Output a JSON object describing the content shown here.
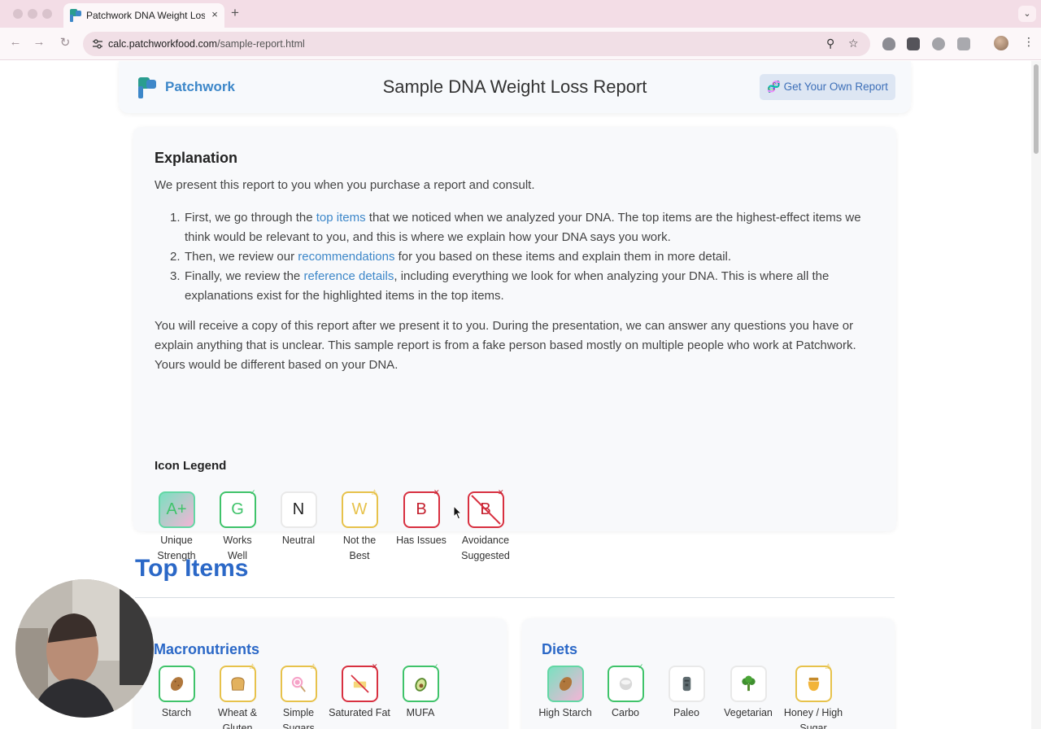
{
  "browser": {
    "tab_title": "Patchwork DNA Weight Loss",
    "tab_close": "×",
    "new_tab": "+",
    "tab_menu": "⌄",
    "url_host": "calc.patchworkfood.com",
    "url_path": "/sample-report.html",
    "back": "←",
    "forward": "→",
    "reload": "↻",
    "zoom_icon": "⚲",
    "bookmark_icon": "☆",
    "more": "⋮"
  },
  "header": {
    "brand": "Patchwork",
    "title": "Sample DNA Weight Loss Report",
    "cta": "🧬 Get Your Own Report"
  },
  "explanation": {
    "heading": "Explanation",
    "intro": "We present this report to you when you purchase a report and consult.",
    "steps": [
      {
        "num": "1.",
        "pre": "First, we go through the ",
        "link": "top items",
        "post": " that we noticed when we analyzed your DNA. The top items are the highest-effect items we think would be relevant to you, and this is where we explain how your DNA says you work."
      },
      {
        "num": "2.",
        "pre": "Then, we review our ",
        "link": "recommendations",
        "post": " for you based on these items and explain them in more detail."
      },
      {
        "num": "3.",
        "pre": "Finally, we review the ",
        "link": "reference details",
        "post": ", including everything we look for when analyzing your DNA. This is where all the explanations exist for the highlighted items in the top items."
      }
    ],
    "after": "You will receive a copy of this report after we present it to you. During the presentation, we can answer any questions you have or explain anything that is unclear. This sample report is from a fake person based mostly on multiple people who work at Patchwork. Yours would be different based on your DNA."
  },
  "legend": {
    "heading": "Icon Legend",
    "items": [
      {
        "letter": "A+",
        "label1": "Unique",
        "label2": "Strength"
      },
      {
        "letter": "G",
        "label1": "Works",
        "label2": "Well",
        "badge": "✓"
      },
      {
        "letter": "N",
        "label1": "Neutral",
        "label2": ""
      },
      {
        "letter": "W",
        "label1": "Not the",
        "label2": "Best",
        "badge": "⚠"
      },
      {
        "letter": "B",
        "label1": "Has Issues",
        "label2": "",
        "badge": "✕"
      },
      {
        "letter": "B",
        "label1": "Avoidance",
        "label2": "Suggested",
        "badge": "✕"
      }
    ]
  },
  "top_items": {
    "heading": "Top Items",
    "macronutrients": {
      "title": "Macronutrients",
      "items": [
        "Starch",
        "Wheat & Gluten",
        "Simple Sugars",
        "Saturated Fat",
        "MUFA"
      ]
    },
    "diets": {
      "title": "Diets",
      "items": [
        "High Starch",
        "Carbo",
        "Paleo",
        "Vegetarian",
        "Honey / High Sugar"
      ]
    }
  },
  "colors": {
    "brand_blue": "#3d87c9",
    "heading_blue": "#2b68c7",
    "green": "#3fc36a",
    "yellow": "#e7c24b",
    "red": "#d83040"
  }
}
